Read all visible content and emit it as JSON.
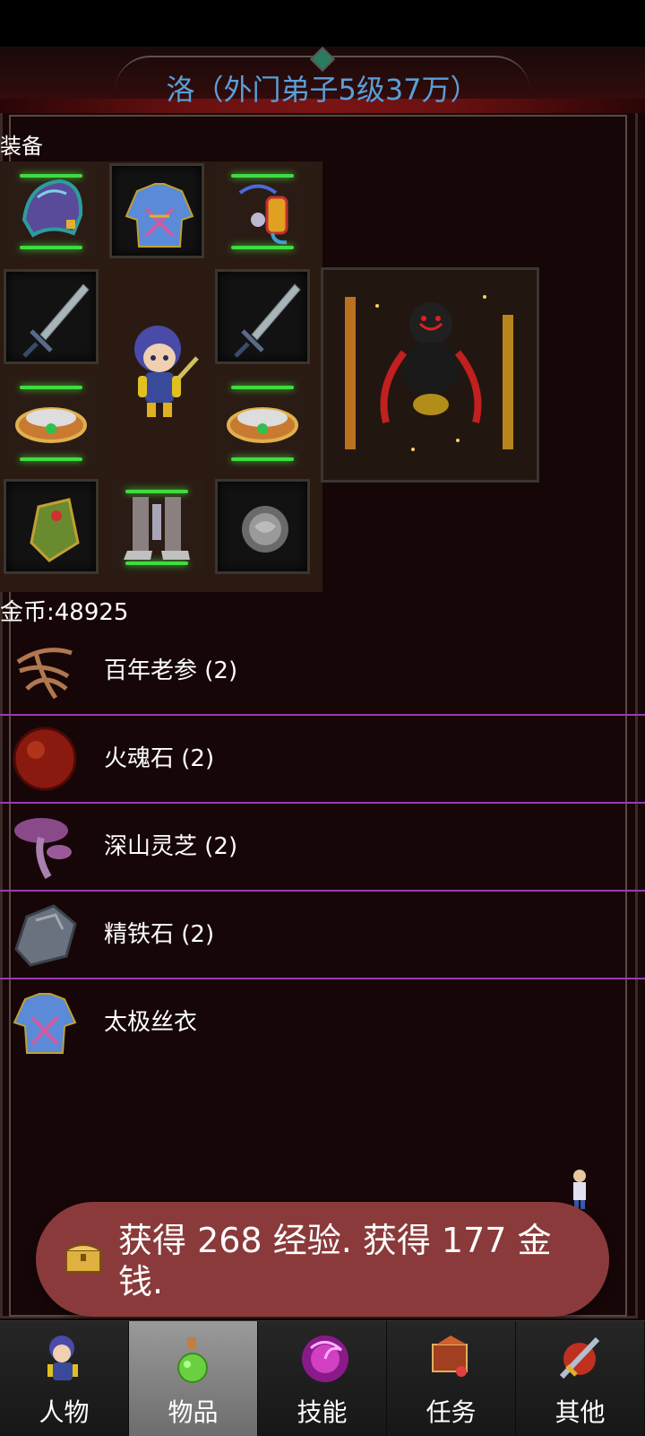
{
  "header": {
    "title": "洛（外门弟子5级37万）"
  },
  "equipment": {
    "label": "装备"
  },
  "currency": {
    "gold_text": "金币:48925"
  },
  "inventory": [
    {
      "name": "百年老参 (2)",
      "icon": "ginseng-icon"
    },
    {
      "name": "火魂石 (2)",
      "icon": "fire-soul-stone-icon"
    },
    {
      "name": "深山灵芝 (2)",
      "icon": "lingzhi-mushroom-icon"
    },
    {
      "name": "精铁石 (2)",
      "icon": "iron-ore-icon"
    },
    {
      "name": "太极丝衣",
      "icon": "silk-robe-icon"
    }
  ],
  "toast": {
    "message": "获得 268 经验. 获得 177 金钱."
  },
  "nav": {
    "tabs": [
      {
        "label": "人物",
        "icon": "character-icon",
        "active": false
      },
      {
        "label": "物品",
        "icon": "potion-icon",
        "active": true
      },
      {
        "label": "技能",
        "icon": "skill-orb-icon",
        "active": false
      },
      {
        "label": "任务",
        "icon": "quest-icon",
        "active": false
      },
      {
        "label": "其他",
        "icon": "other-sword-icon",
        "active": false
      }
    ]
  },
  "colors": {
    "title": "#5a9fd8",
    "glow": "#3fdc3f",
    "divider": "#9b3ab1",
    "toast": "#8a3a3a"
  }
}
